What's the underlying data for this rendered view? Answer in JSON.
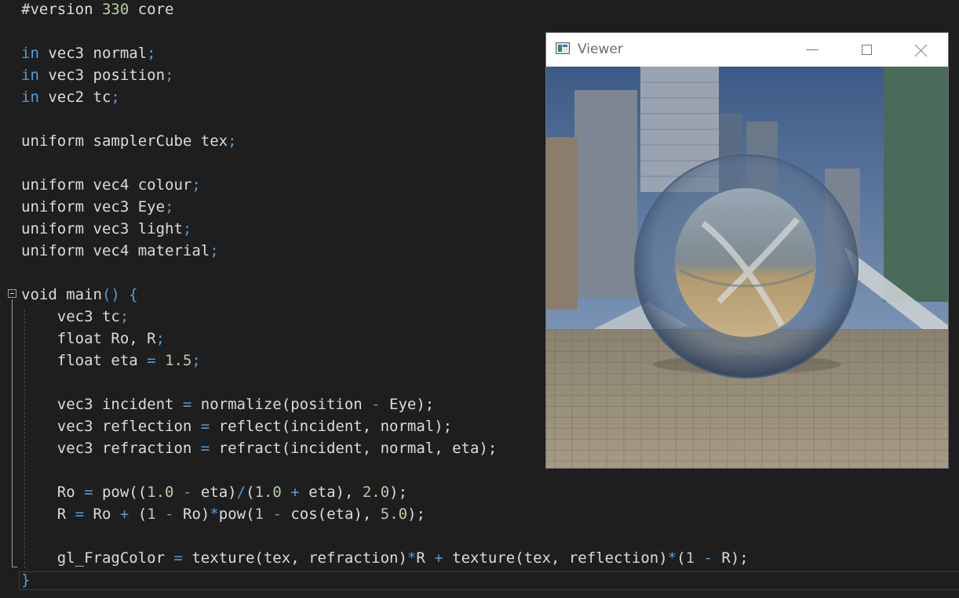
{
  "editor": {
    "lines": [
      {
        "row": 0,
        "parts": [
          {
            "t": "#version ",
            "c": ""
          },
          {
            "t": "330",
            "c": "num"
          },
          {
            "t": " core",
            "c": ""
          }
        ]
      },
      {
        "row": 2,
        "parts": [
          {
            "t": "in",
            "c": "kw"
          },
          {
            "t": " vec3 normal",
            "c": ""
          },
          {
            "t": ";",
            "c": "kw"
          }
        ]
      },
      {
        "row": 3,
        "parts": [
          {
            "t": "in",
            "c": "kw"
          },
          {
            "t": " vec3 position",
            "c": ""
          },
          {
            "t": ";",
            "c": "kw"
          }
        ]
      },
      {
        "row": 4,
        "parts": [
          {
            "t": "in",
            "c": "kw"
          },
          {
            "t": " vec2 tc",
            "c": ""
          },
          {
            "t": ";",
            "c": "kw"
          }
        ]
      },
      {
        "row": 6,
        "parts": [
          {
            "t": "uniform samplerCube tex",
            "c": ""
          },
          {
            "t": ";",
            "c": "kw"
          }
        ]
      },
      {
        "row": 8,
        "parts": [
          {
            "t": "uniform vec4 colour",
            "c": ""
          },
          {
            "t": ";",
            "c": "kw"
          }
        ]
      },
      {
        "row": 9,
        "parts": [
          {
            "t": "uniform vec3 Eye",
            "c": ""
          },
          {
            "t": ";",
            "c": "kw"
          }
        ]
      },
      {
        "row": 10,
        "parts": [
          {
            "t": "uniform vec3 light",
            "c": ""
          },
          {
            "t": ";",
            "c": "kw"
          }
        ]
      },
      {
        "row": 11,
        "parts": [
          {
            "t": "uniform vec4 material",
            "c": ""
          },
          {
            "t": ";",
            "c": "kw"
          }
        ]
      },
      {
        "row": 13,
        "parts": [
          {
            "t": "void main",
            "c": ""
          },
          {
            "t": "() {",
            "c": "kw"
          }
        ]
      },
      {
        "row": 14,
        "parts": [
          {
            "t": "    vec3 tc",
            "c": ""
          },
          {
            "t": ";",
            "c": "kw"
          }
        ]
      },
      {
        "row": 15,
        "parts": [
          {
            "t": "    float Ro, R",
            "c": ""
          },
          {
            "t": ";",
            "c": "kw"
          }
        ]
      },
      {
        "row": 16,
        "parts": [
          {
            "t": "    float eta ",
            "c": ""
          },
          {
            "t": "=",
            "c": "kw"
          },
          {
            "t": " ",
            "c": ""
          },
          {
            "t": "1.5",
            "c": "num"
          },
          {
            "t": ";",
            "c": "kw"
          }
        ]
      },
      {
        "row": 18,
        "parts": [
          {
            "t": "    vec3 incident ",
            "c": ""
          },
          {
            "t": "=",
            "c": "kw"
          },
          {
            "t": " normalize(position ",
            "c": ""
          },
          {
            "t": "-",
            "c": "kw"
          },
          {
            "t": " Eye);",
            "c": ""
          }
        ]
      },
      {
        "row": 19,
        "parts": [
          {
            "t": "    vec3 reflection ",
            "c": ""
          },
          {
            "t": "=",
            "c": "kw"
          },
          {
            "t": " reflect(incident, normal);",
            "c": ""
          }
        ]
      },
      {
        "row": 20,
        "parts": [
          {
            "t": "    vec3 refraction ",
            "c": ""
          },
          {
            "t": "=",
            "c": "kw"
          },
          {
            "t": " refract(incident, normal, eta);",
            "c": ""
          }
        ]
      },
      {
        "row": 22,
        "parts": [
          {
            "t": "    Ro ",
            "c": ""
          },
          {
            "t": "=",
            "c": "kw"
          },
          {
            "t": " pow((",
            "c": ""
          },
          {
            "t": "1.0",
            "c": "num"
          },
          {
            "t": " ",
            "c": ""
          },
          {
            "t": "-",
            "c": "kw"
          },
          {
            "t": " eta)",
            "c": ""
          },
          {
            "t": "/",
            "c": "kw"
          },
          {
            "t": "(",
            "c": ""
          },
          {
            "t": "1.0",
            "c": "num"
          },
          {
            "t": " ",
            "c": ""
          },
          {
            "t": "+",
            "c": "kw"
          },
          {
            "t": " eta), ",
            "c": ""
          },
          {
            "t": "2.0",
            "c": "num"
          },
          {
            "t": ");",
            "c": ""
          }
        ]
      },
      {
        "row": 23,
        "parts": [
          {
            "t": "    R ",
            "c": ""
          },
          {
            "t": "=",
            "c": "kw"
          },
          {
            "t": " Ro ",
            "c": ""
          },
          {
            "t": "+",
            "c": "kw"
          },
          {
            "t": " (",
            "c": ""
          },
          {
            "t": "1",
            "c": "num"
          },
          {
            "t": " ",
            "c": ""
          },
          {
            "t": "-",
            "c": "kw"
          },
          {
            "t": " Ro)",
            "c": ""
          },
          {
            "t": "*",
            "c": "kw"
          },
          {
            "t": "pow(",
            "c": ""
          },
          {
            "t": "1",
            "c": "num"
          },
          {
            "t": " ",
            "c": ""
          },
          {
            "t": "-",
            "c": "kw"
          },
          {
            "t": " cos(eta), ",
            "c": ""
          },
          {
            "t": "5.0",
            "c": "num"
          },
          {
            "t": ");",
            "c": ""
          }
        ]
      },
      {
        "row": 25,
        "parts": [
          {
            "t": "    gl_FragColor ",
            "c": ""
          },
          {
            "t": "=",
            "c": "kw"
          },
          {
            "t": " texture(tex, refraction)",
            "c": ""
          },
          {
            "t": "*",
            "c": "kw"
          },
          {
            "t": "R ",
            "c": ""
          },
          {
            "t": "+",
            "c": "kw"
          },
          {
            "t": " texture(tex, reflection)",
            "c": ""
          },
          {
            "t": "*",
            "c": "kw"
          },
          {
            "t": "(",
            "c": ""
          },
          {
            "t": "1",
            "c": "num"
          },
          {
            "t": " ",
            "c": ""
          },
          {
            "t": "-",
            "c": "kw"
          },
          {
            "t": " R);",
            "c": ""
          }
        ]
      },
      {
        "row": 26,
        "parts": [
          {
            "t": "}",
            "c": "kw"
          }
        ]
      }
    ]
  },
  "viewer": {
    "title": "Viewer",
    "icons": {
      "app": "app-window-icon",
      "minimize": "minimize-icon",
      "maximize": "maximize-icon",
      "close": "close-icon"
    }
  },
  "colors": {
    "editor_bg": "#1e1e1e",
    "keyword": "#569cd6",
    "number": "#b5cea8",
    "text": "#dcdcdc"
  }
}
